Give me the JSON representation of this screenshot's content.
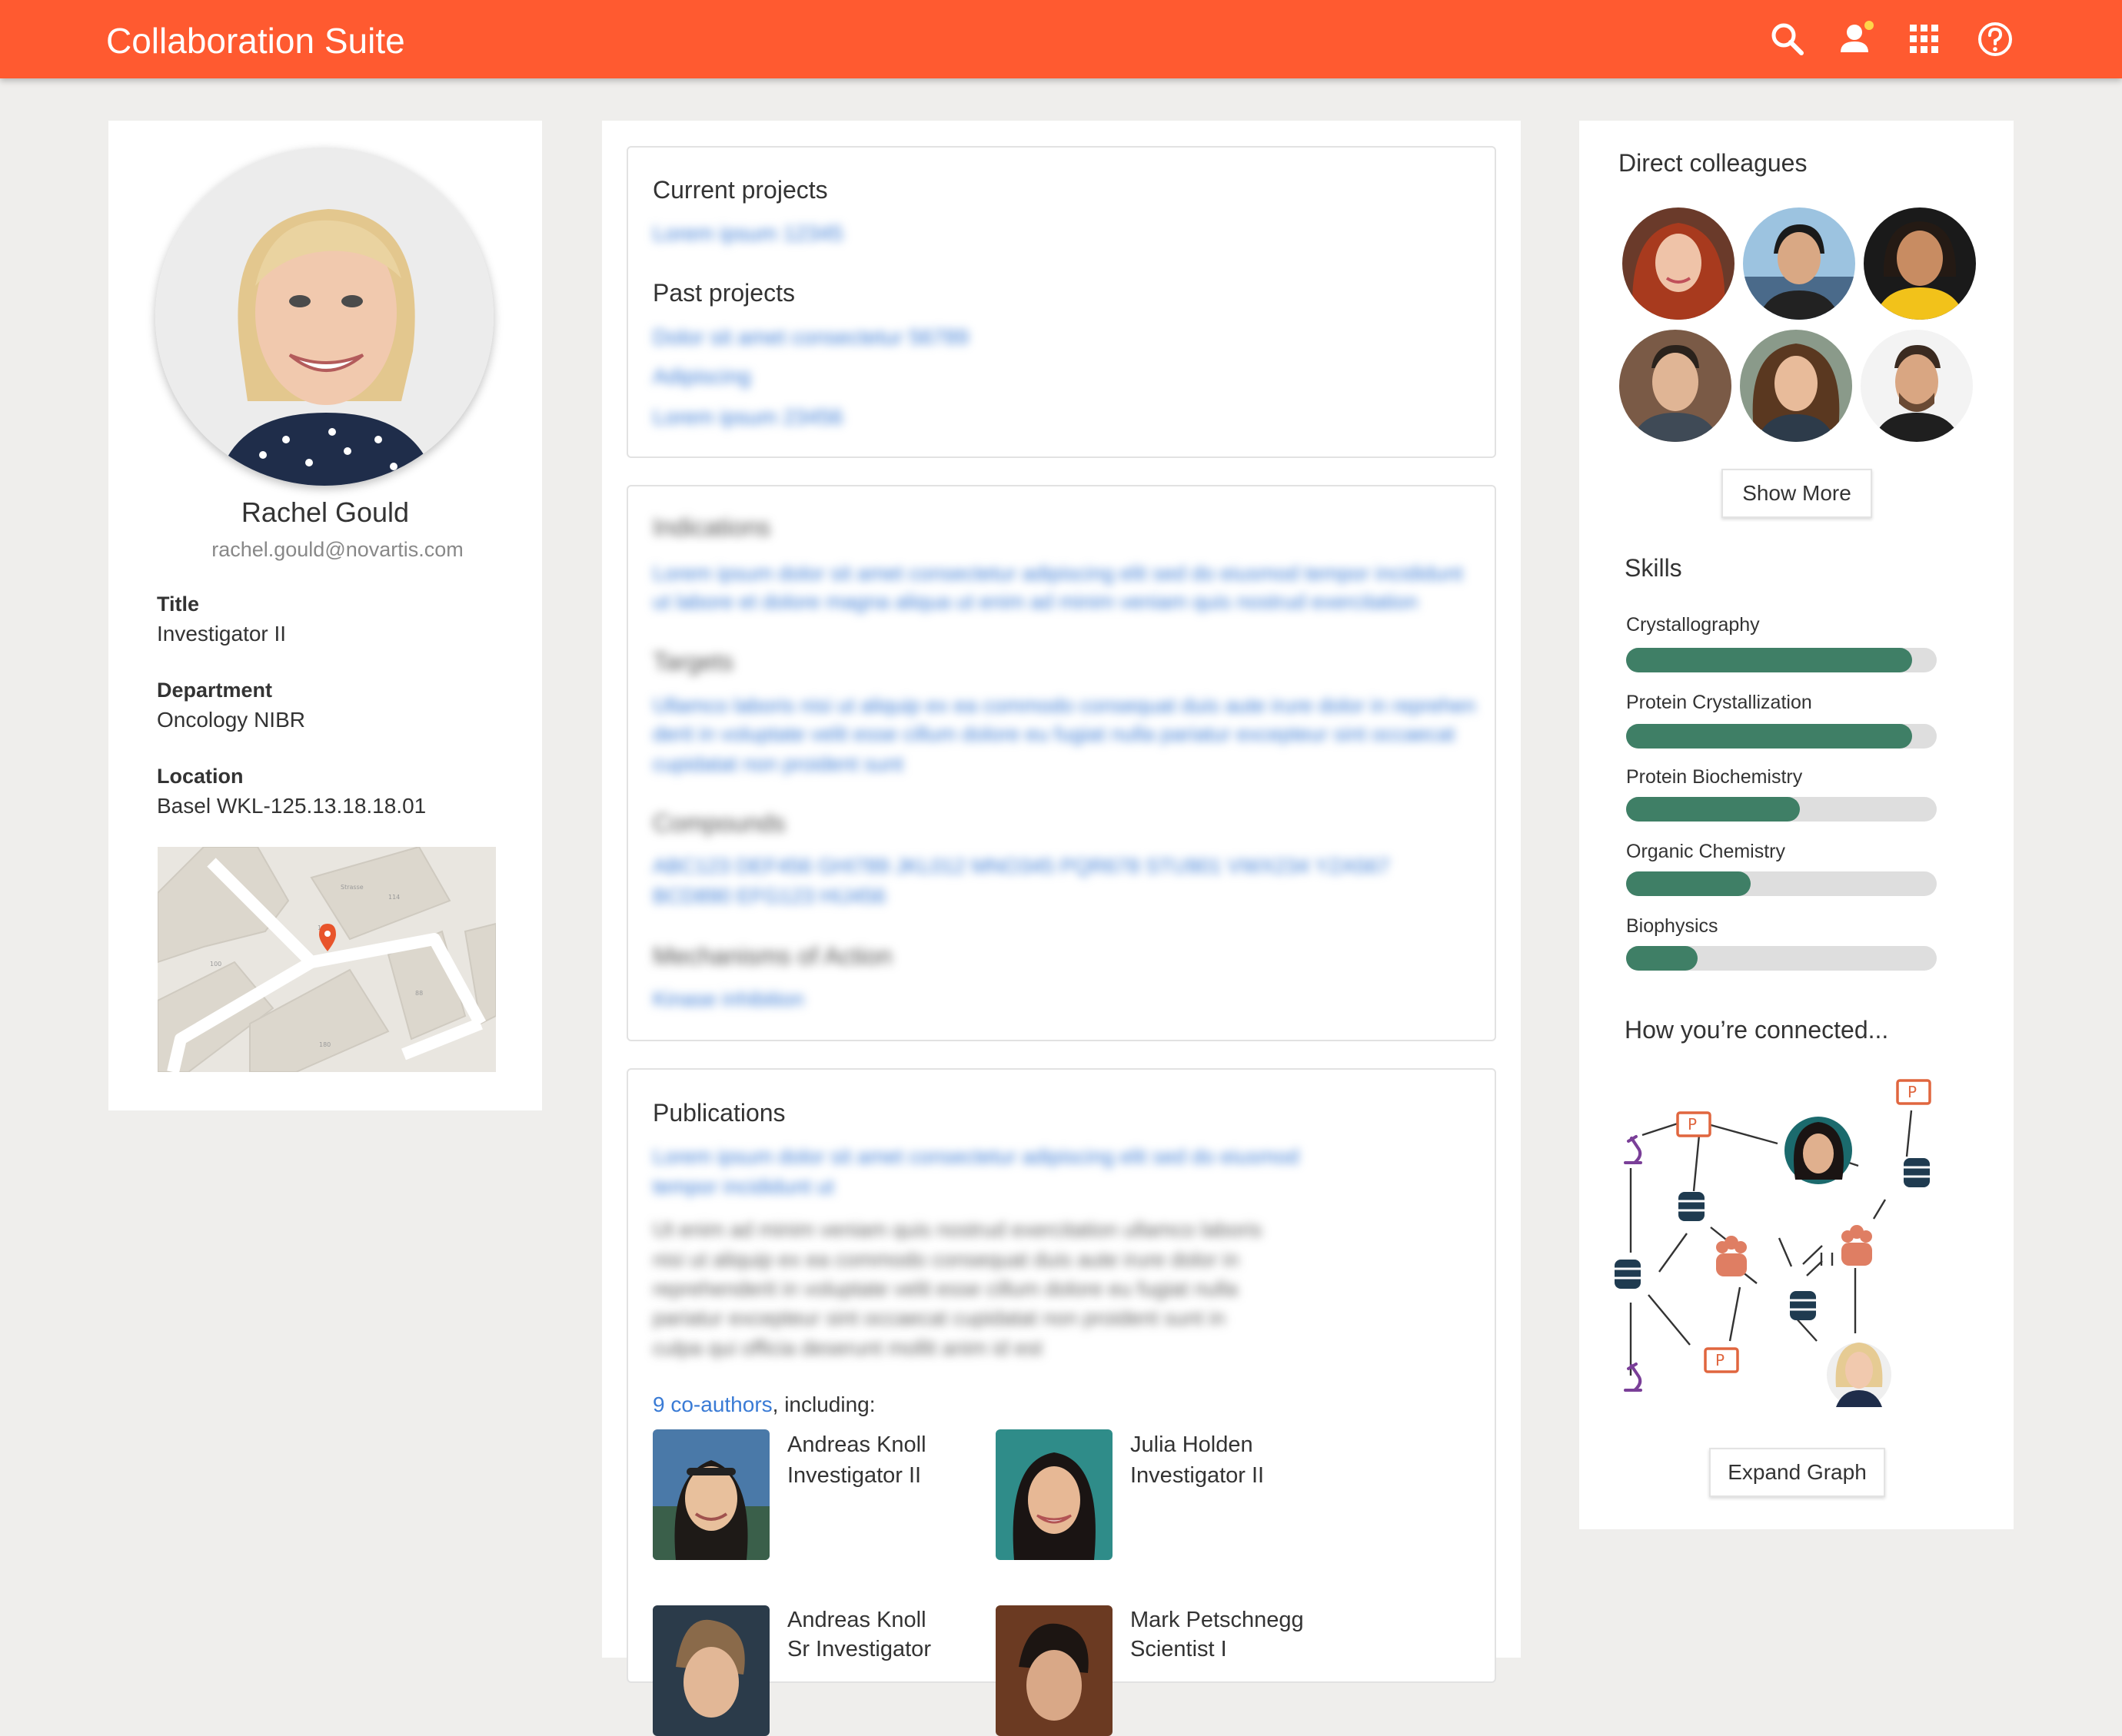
{
  "app": {
    "title": "Collaboration Suite"
  },
  "header_icons": [
    "search-icon",
    "account-notification-icon",
    "apps-grid-icon",
    "help-icon"
  ],
  "colors": {
    "accent": "#ff5a30",
    "skill_bar": "#3f7f66",
    "link": "#3a7bd5",
    "pin": "#e8542b"
  },
  "profile": {
    "name": "Rachel Gould",
    "email": "rachel.gould@novartis.com",
    "fields": [
      {
        "label": "Title",
        "value": "Investigator II"
      },
      {
        "label": "Department",
        "value": "Oncology NIBR"
      },
      {
        "label": "Location",
        "value": "Basel WKL-125.13.18.18.01"
      }
    ]
  },
  "projects": {
    "current_title": "Current projects",
    "current": [
      "Lorem ipsum 12345"
    ],
    "past_title": "Past projects",
    "past": [
      "Dolor sit amet consectetur 56789",
      "Adipiscing",
      "Lorem ipsum 23456"
    ]
  },
  "details": {
    "indications_title": "Indications",
    "indications": [
      "Lorem ipsum dolor sit amet consectetur adipiscing elit sed do eiusmod tempor incididunt",
      "ut labore et dolore magna aliqua ut enim ad minim veniam quis nostrud exercitation"
    ],
    "targets_title": "Targets",
    "targets": [
      "Ullamco laboris nisi ut aliquip ex ea commodo consequat duis aute irure dolor in reprehen",
      "derit in voluptate velit esse cillum dolore eu fugiat nulla pariatur excepteur sint occaecat",
      "cupidatat non proident sunt"
    ],
    "compounds_title": "Compounds",
    "compounds": [
      "ABC123 DEF456 GHI789 JKL012 MNO345 PQR678 STU901 VWX234 YZA567",
      "BCD890 EFG123 HIJ456"
    ],
    "mechanisms_title": "Mechanisms of Action",
    "mechanisms": [
      "Kinase inhibition"
    ]
  },
  "publications": {
    "title": "Publications",
    "link_lines": [
      "Lorem ipsum dolor sit amet consectetur adipiscing elit sed do eiusmod",
      "tempor incididunt ut"
    ],
    "abstract_lines": [
      "Ut enim ad minim veniam quis nostrud exercitation ullamco laboris",
      "nisi ut aliquip ex ea commodo consequat duis aute irure dolor in",
      "reprehenderit in voluptate velit esse cillum dolore eu fugiat nulla",
      "pariatur excepteur sint occaecat cupidatat non proident sunt in",
      "culpa qui officia deserunt mollit anim id est"
    ],
    "coauthors_link": "9 co-authors",
    "coauthors_suffix": ", including:",
    "coauthors": [
      {
        "name": "Andreas Knoll",
        "role": "Investigator II"
      },
      {
        "name": "Julia Holden",
        "role": "Investigator II"
      },
      {
        "name": "Andreas Knoll",
        "role": "Sr Investigator"
      },
      {
        "name": "Mark Petschnegg",
        "role": "Scientist I"
      }
    ]
  },
  "sidebar": {
    "colleagues_title": "Direct colleagues",
    "show_more": "Show More",
    "skills_title": "Skills",
    "skills": [
      {
        "name": "Crystallography",
        "level": 0.92
      },
      {
        "name": "Protein Crystallization",
        "level": 0.92
      },
      {
        "name": "Protein Biochemistry",
        "level": 0.56
      },
      {
        "name": "Organic Chemistry",
        "level": 0.4
      },
      {
        "name": "Biophysics",
        "level": 0.23
      }
    ],
    "connected_title": "How you’re connected...",
    "expand_graph": "Expand Graph"
  }
}
